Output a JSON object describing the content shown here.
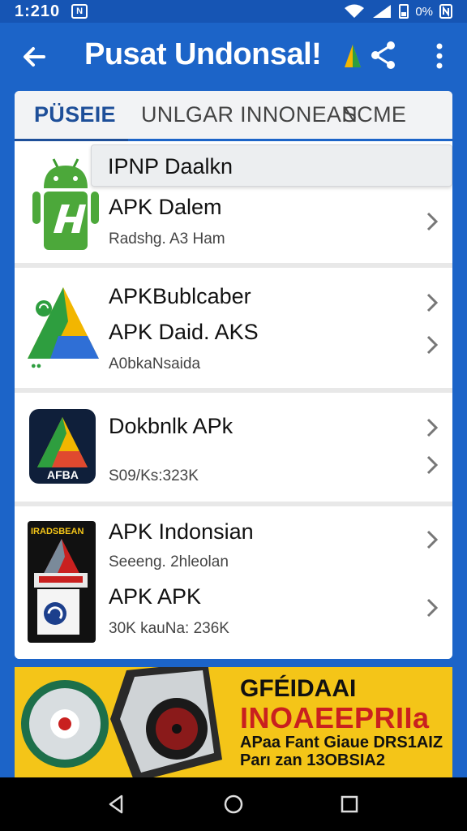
{
  "status_bar": {
    "time": "1:210",
    "battery_text": "0%",
    "notification_glyph": "N"
  },
  "app_bar": {
    "title": "Pusat Undonsal!",
    "icons": [
      "back-arrow-icon",
      "brand-triangle-icon",
      "share-icon",
      "more-vert-icon"
    ]
  },
  "tabs": [
    {
      "label": "PÜSEIE",
      "active": true
    },
    {
      "label": "UNLGAR INNONEAN",
      "active": false
    },
    {
      "label": "SCME",
      "active": false
    }
  ],
  "list": {
    "search_chip": "IPNP Daalkn",
    "items": [
      {
        "lines": [
          "APK Dalem"
        ],
        "sub": "Radshg. A3 Ham",
        "icon": "android-robot-icon"
      },
      {
        "lines": [
          "APKBublcaber",
          "APK Daid. AKS"
        ],
        "sub": "A0bkaNsaida",
        "icon": "triangle-logo-icon"
      },
      {
        "lines": [
          "Dokbnlk APk"
        ],
        "sub": "S09/Ks:323K",
        "icon": "gradient-a-logo-icon",
        "icon_text": "AFBA"
      },
      {
        "lines": [
          "APK Indonsian",
          "APK  APK"
        ],
        "subs": [
          "Seeeng. 2hleolan",
          "30K kauNa: 236K"
        ],
        "icon": "robot-box-icon",
        "icon_text": "IRADSBEAN"
      }
    ]
  },
  "banner": {
    "line1": "GFÉIDAAI",
    "line2": "INOAEEPRIIa",
    "line3": "APaa Fant Giaue DRS1AIZ",
    "line4": "Parı zan 13OBSIA2",
    "icons": [
      "disc-icon",
      "speaker-device-icon"
    ]
  },
  "colors": {
    "primary": "#1c64c8",
    "banner_yellow": "#f4c518",
    "banner_red": "#c9201f",
    "active_tab": "#1e4f99"
  },
  "nav_bar": {
    "icons": [
      "back-triangle-icon",
      "home-circle-icon",
      "recents-square-icon"
    ]
  }
}
